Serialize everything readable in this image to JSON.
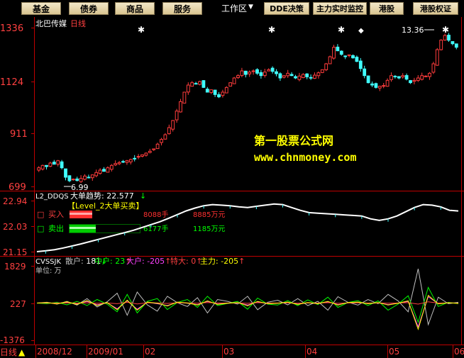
{
  "toolbar": {
    "buttons": [
      {
        "label": "基金",
        "style": "btn"
      },
      {
        "label": "债券",
        "style": "btn"
      },
      {
        "label": "商品",
        "style": "btn"
      },
      {
        "label": "服务",
        "style": "btn"
      },
      {
        "label": "工作区",
        "style": "plain"
      },
      {
        "label": "DDE决策",
        "style": "btn"
      },
      {
        "label": "主力实时监控",
        "style": "btn"
      },
      {
        "label": "港股",
        "style": "btn"
      },
      {
        "label": "港股权证",
        "style": "btn"
      }
    ],
    "workspace_arrow": "▼"
  },
  "colors": {
    "up": "#ff3c3c",
    "down": "#40ffff",
    "axis": "#c00000",
    "label_red": "#ff4040",
    "white": "#ffffff",
    "yellow": "#ffff00",
    "green": "#00ff00",
    "magenta": "#ff40ff",
    "gray": "#c0c0c0"
  },
  "main": {
    "stock_name": "北巴传媒",
    "period": "日线",
    "y_ticks": [
      "1336",
      "1124",
      "911",
      "699"
    ],
    "watermark_title": "第一股票公式网",
    "watermark_url": "www.chnmoney.com",
    "high_label": "13.36",
    "low_label": "6.99",
    "star_markers": [
      "✱",
      "✱",
      "✱",
      "✱",
      "✱"
    ],
    "diamond_marker": "◆"
  },
  "panel2": {
    "indicator": "L2_DDQS",
    "trend_label": "大单趋势: 22.577",
    "trend_arrow": "↓",
    "subtitle": "【Level_2大单买卖】",
    "y_ticks": [
      "22.94",
      "22.03",
      "21.15"
    ],
    "buy_label": "买入",
    "buy_hands": "8088手",
    "buy_amount": "8885万元",
    "sell_label": "卖出",
    "sell_hands": "6177手",
    "sell_amount": "1185万元",
    "checkbox": "□"
  },
  "panel3": {
    "indicator": "CVSSJK",
    "unit_label": "单位: 万",
    "y_ticks": [
      "1829",
      "227",
      "-1376"
    ],
    "legend": [
      {
        "name": "散户",
        "value": "181",
        "arrow": "↓"
      },
      {
        "name": "中户",
        "value": "23",
        "arrow": "↑"
      },
      {
        "name": "大户",
        "value": "-205",
        "arrow": "↑"
      },
      {
        "name": "特大",
        "value": "0",
        "arrow": "↑"
      },
      {
        "name": "主力",
        "value": "-205",
        "arrow": "↑"
      }
    ]
  },
  "bottom": {
    "period_button": "日线",
    "period_arrow": "▲",
    "dates": [
      "2008/12",
      "2009/01",
      "02",
      "03",
      "04",
      "05",
      "06"
    ]
  },
  "chart_data": {
    "type": "candlestick",
    "price_axis_ticks": [
      1336,
      1124,
      911,
      699
    ],
    "price_ylim": [
      660,
      1380
    ],
    "high_mark": 13.36,
    "low_mark": 6.99,
    "close_trend": [
      760,
      770,
      765,
      780,
      775,
      790,
      760,
      720,
      705,
      712,
      706,
      715,
      725,
      720,
      730,
      740,
      750,
      745,
      760,
      770,
      778,
      782,
      786,
      790,
      795,
      800,
      808,
      815,
      822,
      830,
      840,
      860,
      880,
      900,
      930,
      960,
      1000,
      1040,
      1080,
      1110,
      1120,
      1115,
      1125,
      1100,
      1080,
      1090,
      1070,
      1060,
      1080,
      1100,
      1120,
      1140,
      1150,
      1170,
      1155,
      1165,
      1170,
      1160,
      1150,
      1165,
      1175,
      1168,
      1158,
      1140,
      1150,
      1160,
      1150,
      1140,
      1148,
      1155,
      1145,
      1140,
      1152,
      1162,
      1175,
      1200,
      1230,
      1270,
      1255,
      1240,
      1230,
      1238,
      1225,
      1210,
      1180,
      1150,
      1120,
      1110,
      1100,
      1105,
      1108,
      1130,
      1150,
      1145,
      1140,
      1150,
      1135,
      1120,
      1130,
      1140,
      1150,
      1148,
      1160,
      1200,
      1260,
      1300,
      1320,
      1300,
      1285,
      1270
    ],
    "panels": [
      {
        "name": "L2_DDQS",
        "ylim": [
          21.15,
          22.94
        ],
        "ticks": [
          22.94,
          22.03,
          21.15
        ],
        "series": [
          {
            "name": "大单趋势",
            "values": [
              21.15,
              21.18,
              21.22,
              21.28,
              21.35,
              21.42,
              21.5,
              21.58,
              21.66,
              21.74,
              21.82,
              21.9,
              22.0,
              22.1,
              22.2,
              22.32,
              22.45,
              22.58,
              22.68,
              22.76,
              22.8,
              22.78,
              22.76,
              22.72,
              22.7,
              22.74,
              22.78,
              22.82,
              22.8,
              22.7,
              22.6,
              22.52,
              22.5,
              22.48,
              22.46,
              22.44,
              22.42,
              22.4,
              22.3,
              22.25,
              22.3,
              22.4,
              22.55,
              22.7,
              22.8,
              22.78,
              22.72,
              22.6,
              22.577
            ]
          }
        ]
      },
      {
        "name": "CVSSJK",
        "ylim": [
          -1376,
          1829
        ],
        "ticks": [
          1829,
          227,
          -1376
        ],
        "series": [
          {
            "name": "散户",
            "values": [
              227,
              260,
              180,
              300,
              140,
              420,
              60,
              280,
              650,
              -300,
              700,
              150,
              -120,
              520,
              240,
              80,
              460,
              -200,
              380,
              300,
              180,
              520,
              -60,
              260,
              350,
              150,
              420,
              120,
              300,
              -80,
              500,
              260,
              140,
              380,
              200,
              600,
              320,
              -150,
              1700,
              -700,
              480,
              200,
              260
            ]
          },
          {
            "name": "中户",
            "values": [
              227,
              200,
              260,
              150,
              300,
              120,
              380,
              180,
              -150,
              600,
              -200,
              300,
              420,
              -50,
              250,
              380,
              40,
              520,
              120,
              210,
              300,
              -40,
              440,
              180,
              140,
              330,
              120,
              360,
              160,
              480,
              40,
              250,
              330,
              120,
              320,
              -80,
              180,
              540,
              -600,
              900,
              80,
              260,
              200
            ]
          },
          {
            "name": "大户",
            "values": [
              227,
              240,
              210,
              260,
              190,
              300,
              150,
              240,
              -20,
              320,
              -40,
              260,
              200,
              120,
              260,
              220,
              160,
              300,
              180,
              220,
              240,
              140,
              280,
              200,
              220,
              260,
              180,
              240,
              200,
              280,
              160,
              240,
              260,
              200,
              240,
              160,
              220,
              300,
              -800,
              500,
              200,
              240,
              220
            ]
          },
          {
            "name": "特大",
            "values": [
              227,
              230,
              225,
              235,
              220,
              240,
              215,
              230,
              200,
              260,
              190,
              240,
              230,
              210,
              240,
              230,
              220,
              250,
              225,
              230,
              235,
              215,
              245,
              225,
              230,
              240,
              220,
              235,
              225,
              245,
              215,
              230,
              240,
              225,
              235,
              220,
              230,
              245,
              180,
              280,
              225,
              230,
              227
            ]
          },
          {
            "name": "主力",
            "values": [
              227,
              250,
              190,
              280,
              170,
              330,
              120,
              250,
              -60,
              350,
              -80,
              270,
              220,
              100,
              270,
              230,
              140,
              320,
              170,
              220,
              250,
              110,
              300,
              200,
              220,
              270,
              170,
              250,
              200,
              300,
              140,
              250,
              270,
              200,
              250,
              140,
              220,
              320,
              -900,
              560,
              190,
              240,
              210
            ]
          }
        ]
      }
    ]
  }
}
